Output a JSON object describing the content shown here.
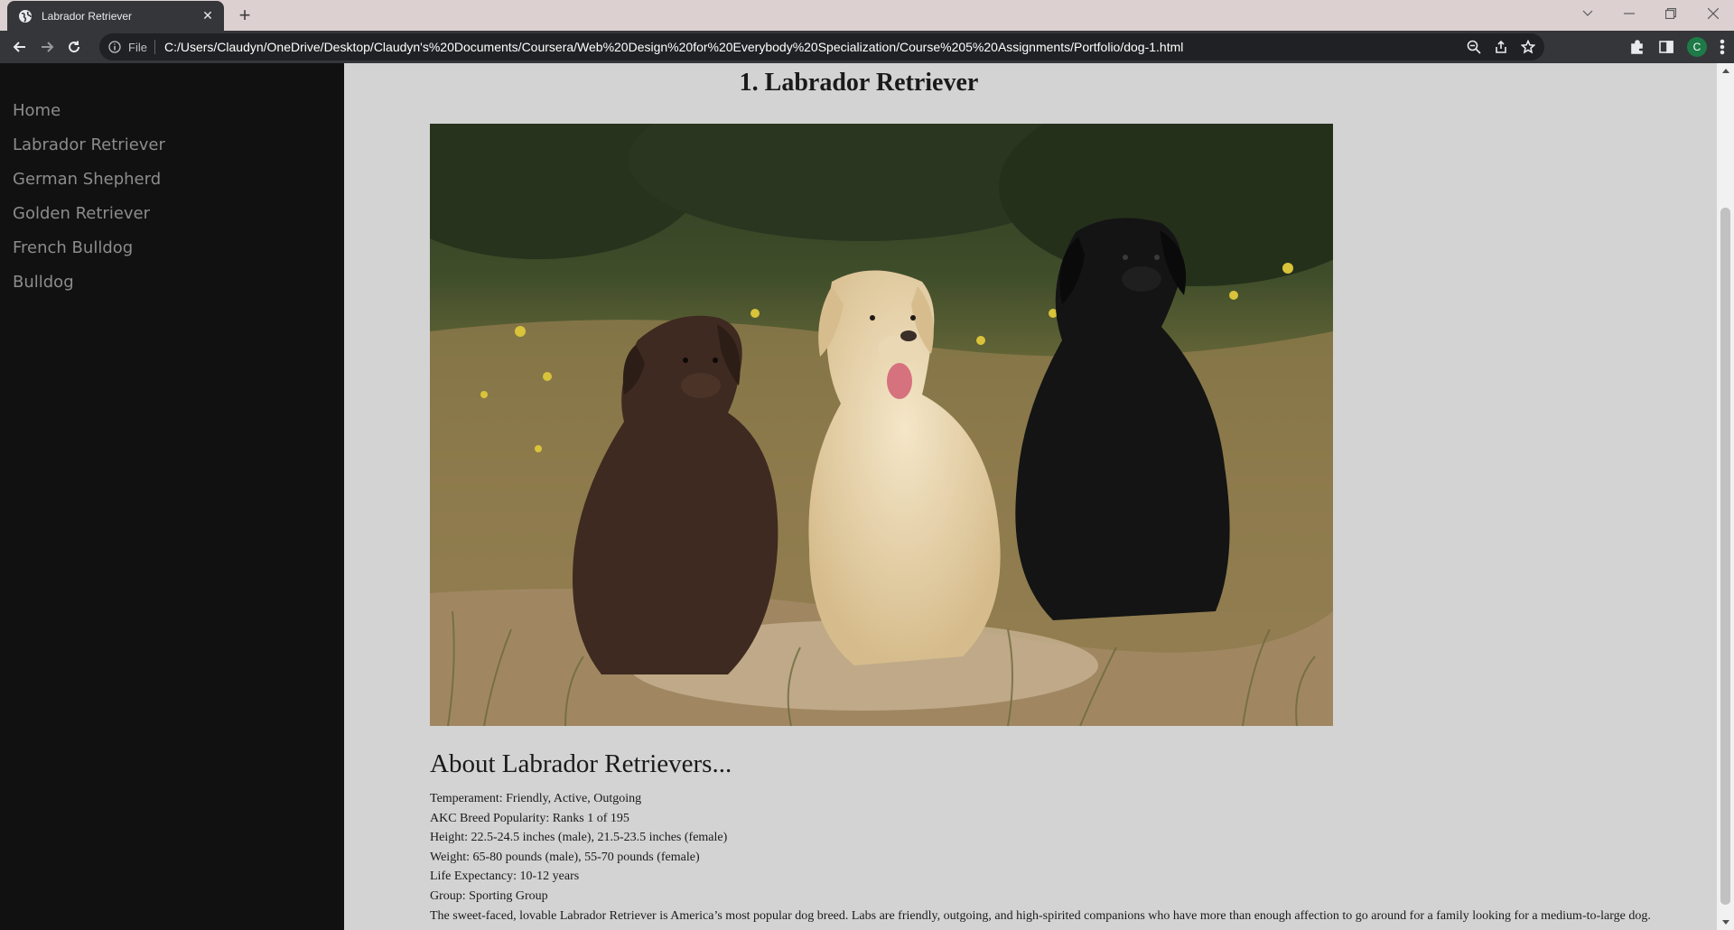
{
  "browser": {
    "tab": {
      "title": "Labrador Retriever",
      "favicon": "globe-icon",
      "close": "✕"
    },
    "new_tab": "+",
    "scheme": "File",
    "url": "C:/Users/Claudyn/OneDrive/Desktop/Claudyn's%20Documents/Coursera/Web%20Design%20for%20Everybody%20Specialization/Course%205%20Assignments/Portfolio/dog-1.html",
    "profile_initial": "C"
  },
  "sidenav": {
    "items": [
      {
        "label": "Home"
      },
      {
        "label": "Labrador Retriever"
      },
      {
        "label": "German Shepherd"
      },
      {
        "label": "Golden Retriever"
      },
      {
        "label": "French Bulldog"
      },
      {
        "label": "Bulldog"
      }
    ]
  },
  "main": {
    "title": "1. Labrador Retriever",
    "image_subject": "three Labrador Retrievers (chocolate, yellow, black) sitting in a grassy meadow",
    "about_heading": "About Labrador Retrievers...",
    "facts": [
      "Temperament: Friendly, Active, Outgoing",
      "AKC Breed Popularity: Ranks 1 of 195",
      "Height: 22.5-24.5 inches (male), 21.5-23.5 inches (female)",
      "Weight: 65-80 pounds (male), 55-70 pounds (female)",
      "Life Expectancy: 10-12 years",
      "Group: Sporting Group",
      "The sweet-faced, lovable Labrador Retriever is America’s most popular dog breed. Labs are friendly, outgoing, and high-spirited companions who have more than enough affection to go around for a family looking for a medium-to-large dog."
    ]
  },
  "colors": {
    "sidenav_bg": "#111111",
    "sidenav_text": "#8c8c8c",
    "main_bg": "#d3d3d3",
    "toolbar_bg": "#35363a",
    "tabstrip_bg": "#dcd0d1"
  }
}
